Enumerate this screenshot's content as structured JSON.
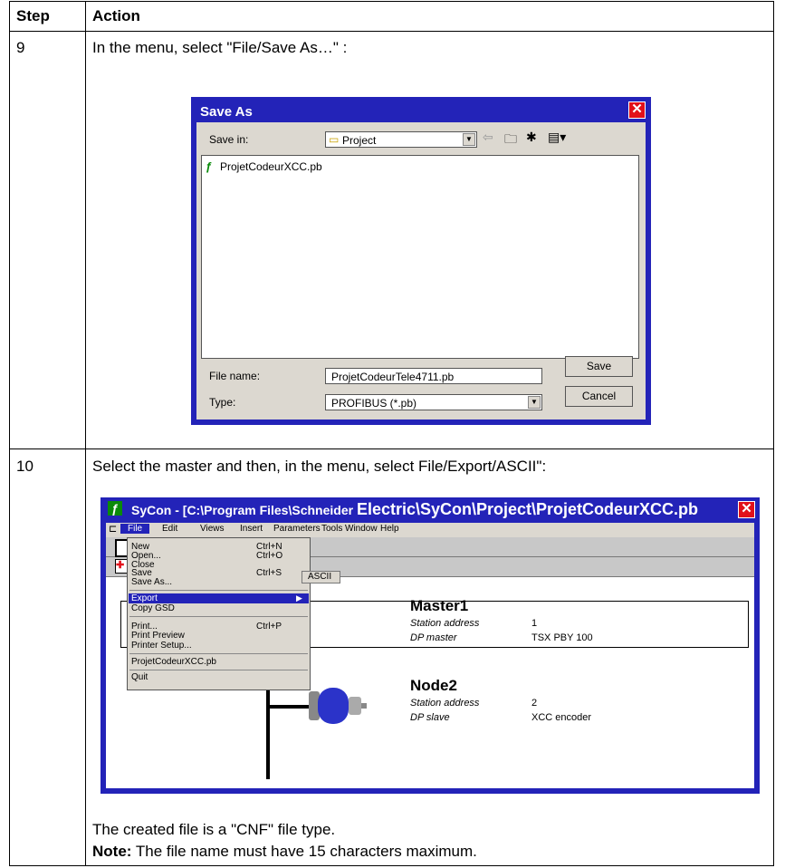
{
  "table": {
    "headers": {
      "step": "Step",
      "action": "Action"
    },
    "rows": [
      {
        "step": "9",
        "instruction": "In the menu, select \"File/Save As…\" :"
      },
      {
        "step": "10",
        "instruction": "Select the master and then, in the menu, select File/Export/ASCII\":"
      }
    ],
    "footer_text": "The created file is a \"CNF\" file type.",
    "note_label": "Note:",
    "note_text": "The file name must have 15 characters maximum."
  },
  "save_as_dialog": {
    "title": "Save As",
    "close_glyph": "✕",
    "save_in_label": "Save in:",
    "save_in_value": "Project",
    "file_items": [
      "ProjetCodeurXCC.pb"
    ],
    "file_name_label": "File name:",
    "file_name_value": "ProjetCodeurTele4711.pb",
    "type_label": "Type:",
    "type_value": "PROFIBUS (*.pb)",
    "save_button": "Save",
    "cancel_button": "Cancel"
  },
  "syscon_window": {
    "title_part1": "SyCon - [C:\\Program Files\\Schneider ",
    "title_part2": "Electric\\SyCon\\Project\\ProjetCodeurXCC.pb",
    "close_glyph": "✕",
    "menu": [
      "File",
      "Edit",
      "Views",
      "Insert",
      "Parameters",
      "Tools",
      "Window",
      "Help"
    ],
    "file_menu": [
      {
        "label": "New",
        "shortcut": "Ctrl+N"
      },
      {
        "label": "Open...",
        "shortcut": "Ctrl+O"
      },
      {
        "label": "Close",
        "shortcut": ""
      },
      {
        "label": "Save",
        "shortcut": "Ctrl+S"
      },
      {
        "label": "Save As...",
        "shortcut": ""
      },
      {
        "label": "Export",
        "shortcut": ""
      },
      {
        "label": "Copy GSD",
        "shortcut": ""
      },
      {
        "label": "Print...",
        "shortcut": "Ctrl+P"
      },
      {
        "label": "Print Preview",
        "shortcut": ""
      },
      {
        "label": "Printer Setup...",
        "shortcut": ""
      },
      {
        "label": "ProjetCodeurXCC.pb",
        "shortcut": ""
      },
      {
        "label": "Quit",
        "shortcut": ""
      }
    ],
    "submenu_item": "ASCII",
    "master": {
      "name": "Master1",
      "station_label": "Station address",
      "station_value": "1",
      "type_label": "DP master",
      "type_value": "TSX PBY 100"
    },
    "node": {
      "name": "Node2",
      "station_label": "Station address",
      "station_value": "2",
      "type_label": "DP slave",
      "type_value": "XCC encoder"
    }
  }
}
